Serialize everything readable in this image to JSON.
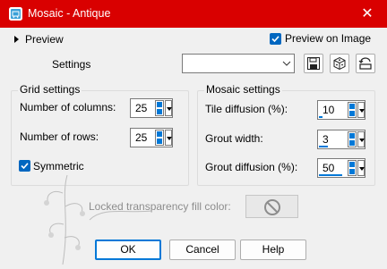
{
  "window": {
    "title": "Mosaic - Antique",
    "close_glyph": "✕",
    "icon": "mosaic-app-icon"
  },
  "top": {
    "preview_label": "Preview",
    "preview_on_image_label": "Preview on Image",
    "preview_on_image_checked": true,
    "settings_label": "Settings",
    "settings_value": ""
  },
  "grid": {
    "title": "Grid settings",
    "columns_label": "Number of columns:",
    "columns_value": "25",
    "rows_label": "Number of rows:",
    "rows_value": "25",
    "symmetric_label": "Symmetric",
    "symmetric_checked": true
  },
  "mosaic": {
    "title": "Mosaic settings",
    "tile_label": "Tile diffusion (%):",
    "tile_value": "10",
    "grout_width_label": "Grout width:",
    "grout_width_value": "3",
    "grout_diffusion_label": "Grout diffusion (%):",
    "grout_diffusion_value": "50"
  },
  "fill": {
    "label": "Locked transparency fill color:"
  },
  "buttons": {
    "ok": "OK",
    "cancel": "Cancel",
    "help": "Help"
  },
  "accent": "#0078d7",
  "title_bar_color": "#d90000"
}
